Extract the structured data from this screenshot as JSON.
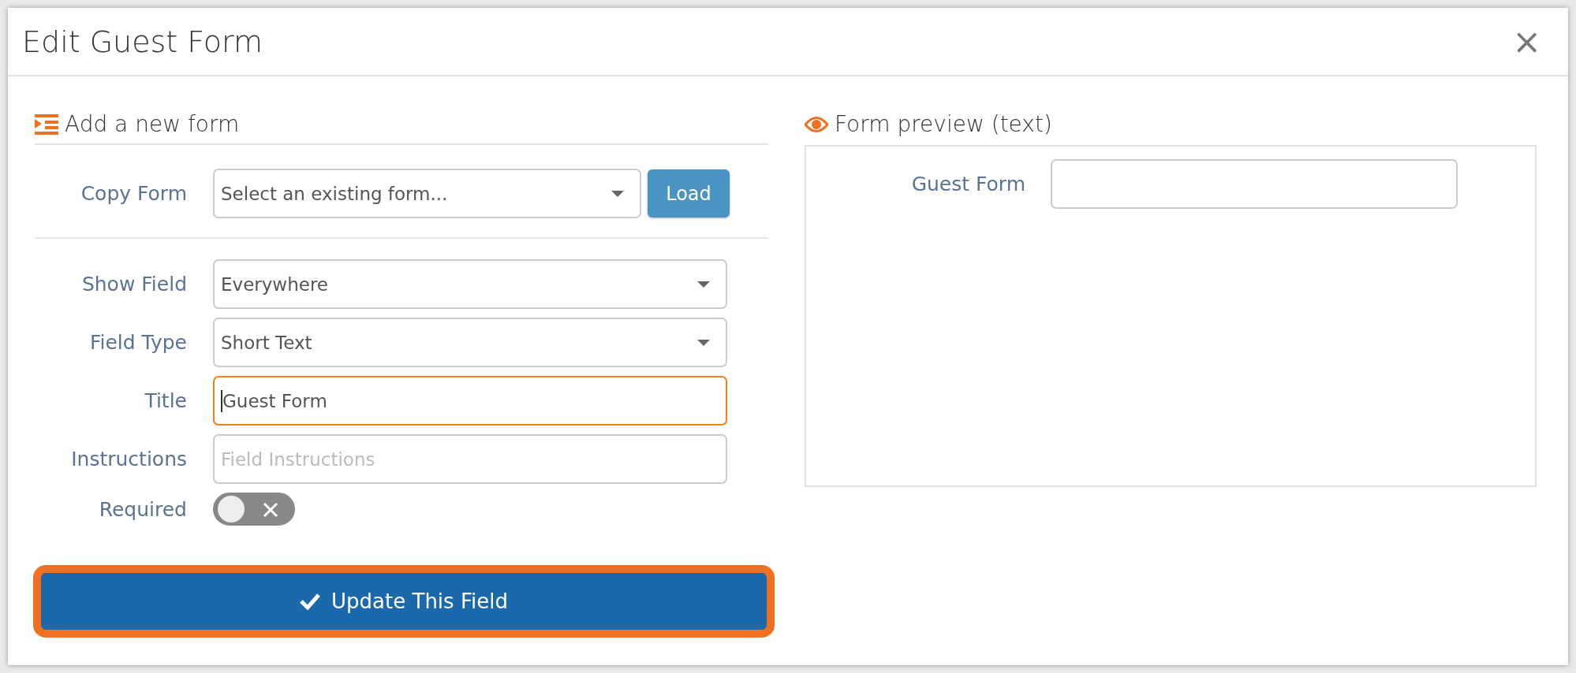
{
  "dialog": {
    "title": "Edit Guest Form",
    "close": "×"
  },
  "editor": {
    "heading": "Add a new form",
    "copy": {
      "label": "Copy Form",
      "placeholder": "Select an existing form...",
      "button": "Load"
    },
    "fields": [
      {
        "kind": "select",
        "label": "Show Field",
        "value": "Everywhere",
        "focused": false
      },
      {
        "kind": "select",
        "label": "Field Type",
        "value": "Short Text",
        "focused": false
      },
      {
        "kind": "text",
        "label": "Title",
        "value": "Guest Form",
        "focused": true
      },
      {
        "kind": "text",
        "label": "Instructions",
        "placeholder": "Field Instructions",
        "focused": false
      },
      {
        "kind": "toggle",
        "label": "Required",
        "on": false
      }
    ],
    "submit": {
      "label": "Update This Field",
      "focused": true
    }
  },
  "preview": {
    "heading": "Form preview (text)",
    "fields": [
      {
        "label": "Guest Form"
      }
    ]
  }
}
